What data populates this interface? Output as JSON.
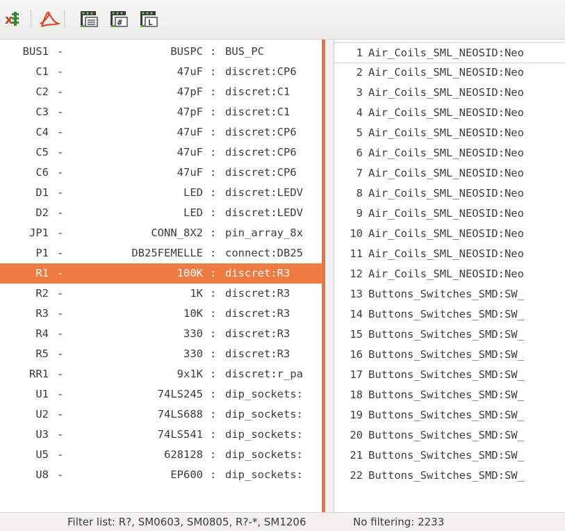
{
  "toolbar": {
    "icons": [
      "delete-association-icon",
      "pdf-document-icon",
      "footprint-filter-icon",
      "footprint-pin-filter-icon",
      "footprint-library-filter-icon"
    ]
  },
  "components": [
    {
      "ref": "BUS1",
      "dash": "-",
      "value": "BUSPC",
      "sep": ":",
      "footprint": "BUS_PC"
    },
    {
      "ref": "C1",
      "dash": "-",
      "value": "47uF",
      "sep": ":",
      "footprint": "discret:CP6"
    },
    {
      "ref": "C2",
      "dash": "-",
      "value": "47pF",
      "sep": ":",
      "footprint": "discret:C1"
    },
    {
      "ref": "C3",
      "dash": "-",
      "value": "47pF",
      "sep": ":",
      "footprint": "discret:C1"
    },
    {
      "ref": "C4",
      "dash": "-",
      "value": "47uF",
      "sep": ":",
      "footprint": "discret:CP6"
    },
    {
      "ref": "C5",
      "dash": "-",
      "value": "47uF",
      "sep": ":",
      "footprint": "discret:CP6"
    },
    {
      "ref": "C6",
      "dash": "-",
      "value": "47uF",
      "sep": ":",
      "footprint": "discret:CP6"
    },
    {
      "ref": "D1",
      "dash": "-",
      "value": "LED",
      "sep": ":",
      "footprint": "discret:LEDV"
    },
    {
      "ref": "D2",
      "dash": "-",
      "value": "LED",
      "sep": ":",
      "footprint": "discret:LEDV"
    },
    {
      "ref": "JP1",
      "dash": "-",
      "value": "CONN_8X2",
      "sep": ":",
      "footprint": "pin_array_8x"
    },
    {
      "ref": "P1",
      "dash": "-",
      "value": "DB25FEMELLE",
      "sep": ":",
      "footprint": "connect:DB25"
    },
    {
      "ref": "R1",
      "dash": "-",
      "value": "100K",
      "sep": ":",
      "footprint": "discret:R3",
      "selected": true
    },
    {
      "ref": "R2",
      "dash": "-",
      "value": "1K",
      "sep": ":",
      "footprint": "discret:R3"
    },
    {
      "ref": "R3",
      "dash": "-",
      "value": "10K",
      "sep": ":",
      "footprint": "discret:R3"
    },
    {
      "ref": "R4",
      "dash": "-",
      "value": "330",
      "sep": ":",
      "footprint": "discret:R3"
    },
    {
      "ref": "R5",
      "dash": "-",
      "value": "330",
      "sep": ":",
      "footprint": "discret:R3"
    },
    {
      "ref": "RR1",
      "dash": "-",
      "value": "9x1K",
      "sep": ":",
      "footprint": "discret:r_pa"
    },
    {
      "ref": "U1",
      "dash": "-",
      "value": "74LS245",
      "sep": ":",
      "footprint": "dip_sockets:"
    },
    {
      "ref": "U2",
      "dash": "-",
      "value": "74LS688",
      "sep": ":",
      "footprint": "dip_sockets:"
    },
    {
      "ref": "U3",
      "dash": "-",
      "value": "74LS541",
      "sep": ":",
      "footprint": "dip_sockets:"
    },
    {
      "ref": "U5",
      "dash": "-",
      "value": "628128",
      "sep": ":",
      "footprint": "dip_sockets:"
    },
    {
      "ref": "U8",
      "dash": "-",
      "value": "EP600",
      "sep": ":",
      "footprint": "dip_sockets:"
    }
  ],
  "footprints": [
    {
      "num": "1",
      "name": "Air_Coils_SML_NEOSID:Neo"
    },
    {
      "num": "2",
      "name": "Air_Coils_SML_NEOSID:Neo"
    },
    {
      "num": "3",
      "name": "Air_Coils_SML_NEOSID:Neo"
    },
    {
      "num": "4",
      "name": "Air_Coils_SML_NEOSID:Neo"
    },
    {
      "num": "5",
      "name": "Air_Coils_SML_NEOSID:Neo"
    },
    {
      "num": "6",
      "name": "Air_Coils_SML_NEOSID:Neo"
    },
    {
      "num": "7",
      "name": "Air_Coils_SML_NEOSID:Neo"
    },
    {
      "num": "8",
      "name": "Air_Coils_SML_NEOSID:Neo"
    },
    {
      "num": "9",
      "name": "Air_Coils_SML_NEOSID:Neo"
    },
    {
      "num": "10",
      "name": "Air_Coils_SML_NEOSID:Neo"
    },
    {
      "num": "11",
      "name": "Air_Coils_SML_NEOSID:Neo"
    },
    {
      "num": "12",
      "name": "Air_Coils_SML_NEOSID:Neo"
    },
    {
      "num": "13",
      "name": "Buttons_Switches_SMD:SW_"
    },
    {
      "num": "14",
      "name": "Buttons_Switches_SMD:SW_"
    },
    {
      "num": "15",
      "name": "Buttons_Switches_SMD:SW_"
    },
    {
      "num": "16",
      "name": "Buttons_Switches_SMD:SW_"
    },
    {
      "num": "17",
      "name": "Buttons_Switches_SMD:SW_"
    },
    {
      "num": "18",
      "name": "Buttons_Switches_SMD:SW_"
    },
    {
      "num": "19",
      "name": "Buttons_Switches_SMD:SW_"
    },
    {
      "num": "20",
      "name": "Buttons_Switches_SMD:SW_"
    },
    {
      "num": "21",
      "name": "Buttons_Switches_SMD:SW_"
    },
    {
      "num": "22",
      "name": "Buttons_Switches_SMD:SW_"
    }
  ],
  "status": {
    "filter_text": "Filter list: R?, SM0603, SM0805, R?-*, SM1206",
    "count_text": "No filtering: 2233"
  },
  "colors": {
    "selection": "#ef7b43",
    "splitter": "#e8733f"
  }
}
